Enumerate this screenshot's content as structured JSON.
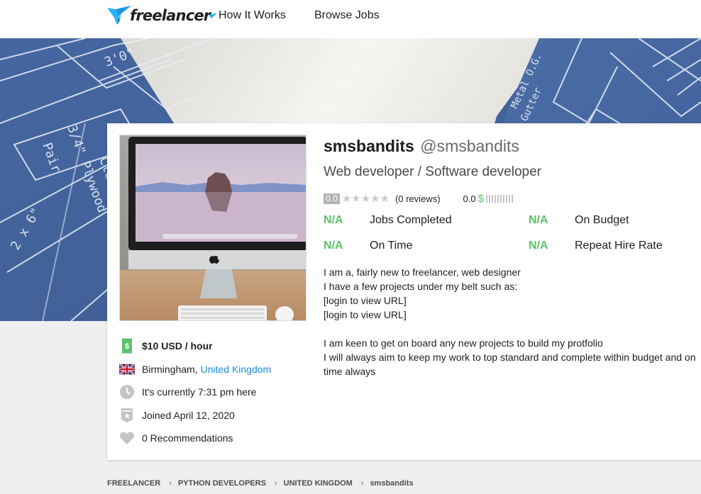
{
  "header": {
    "logo_text": "freelancer",
    "nav": [
      {
        "label": "How It Works"
      },
      {
        "label": "Browse Jobs"
      }
    ]
  },
  "profile": {
    "display_name": "smsbandits",
    "handle": "@smsbandits",
    "tagline": "Web developer / Software developer",
    "rating": {
      "score": "0.0",
      "stars_filled": 0,
      "stars_total": 5,
      "reviews_label": "(0 reviews)",
      "earnings_score": "0.0",
      "earnings_symbol": "$",
      "earnings_bars_total": 10,
      "earnings_bars_filled": 0
    },
    "stats": [
      {
        "value": "N/A",
        "label": "Jobs Completed"
      },
      {
        "value": "N/A",
        "label": "On Budget"
      },
      {
        "value": "N/A",
        "label": "On Time"
      },
      {
        "value": "N/A",
        "label": "Repeat Hire Rate"
      }
    ],
    "bio_lines": [
      "I am a, fairly new to freelancer, web designer",
      "I have a few projects under my belt such as:",
      "[login to view URL]",
      "[login to view URL]",
      "",
      "I am keen to get on board any new projects to build my protfolio",
      "I will always aim to keep my work to top standard and complete within budget and on time always"
    ],
    "info": {
      "hourly_rate": "$10 USD / hour",
      "city": "Birmingham,",
      "country": "United Kingdom",
      "local_time": "It's currently 7:31 pm here",
      "joined": "Joined April 12, 2020",
      "recommendations": "0 Recommendations"
    },
    "icons": {
      "rate": "dollar-ticket-icon",
      "flag": "uk-flag-icon",
      "time": "clock-icon",
      "joined": "badge-star-icon",
      "recommendations": "heart-icon"
    }
  },
  "breadcrumb": [
    {
      "label": "FREELANCER"
    },
    {
      "label": "PYTHON DEVELOPERS"
    },
    {
      "label": "UNITED KINGDOM"
    },
    {
      "label": "smsbandits"
    }
  ],
  "colors": {
    "brand_blue": "#29b2fe",
    "success_green": "#5dc26a",
    "link_blue": "#1a8ee0",
    "muted_gray": "#b3b3b3"
  }
}
